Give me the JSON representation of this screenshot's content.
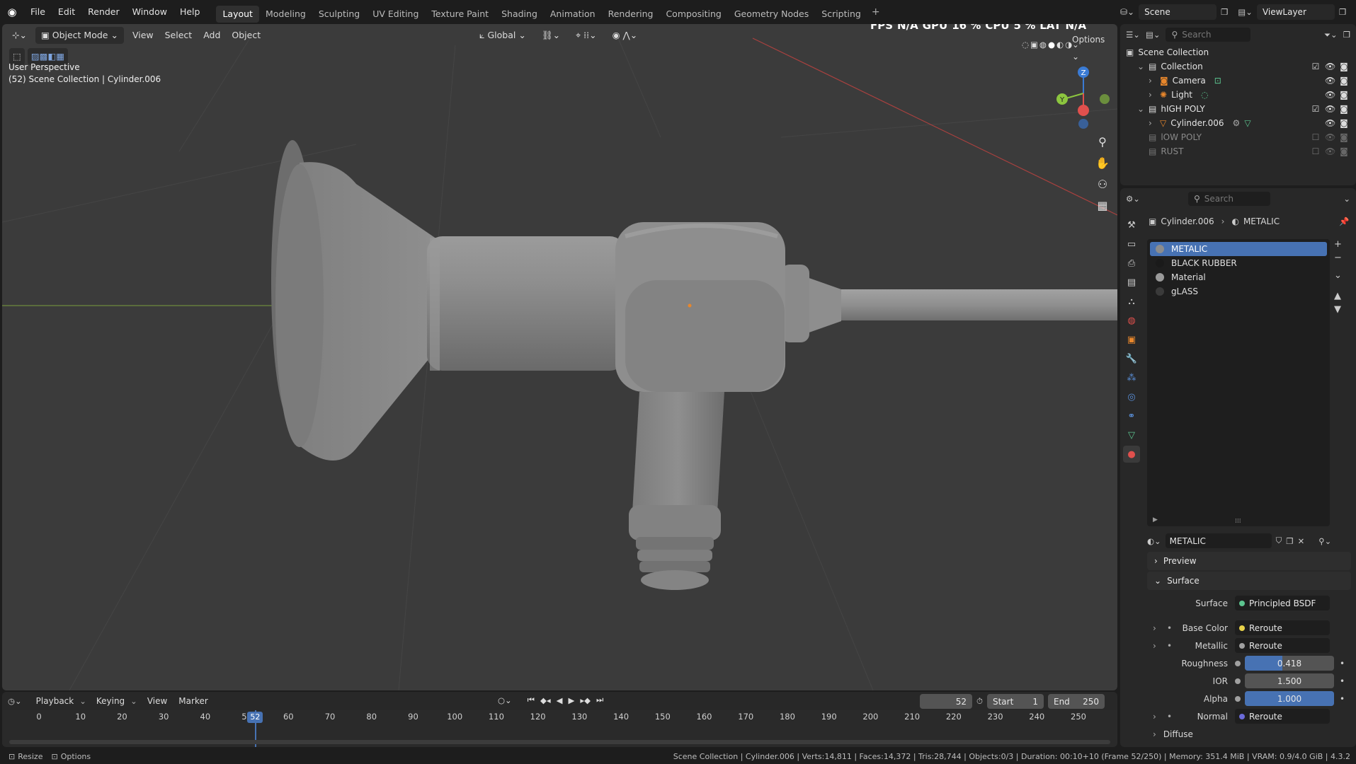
{
  "topbar": {
    "menus": [
      "File",
      "Edit",
      "Render",
      "Window",
      "Help"
    ],
    "workspaces": [
      "Layout",
      "Modeling",
      "Sculpting",
      "UV Editing",
      "Texture Paint",
      "Shading",
      "Animation",
      "Rendering",
      "Compositing",
      "Geometry Nodes",
      "Scripting"
    ],
    "active_workspace": "Layout",
    "scene": "Scene",
    "view_layer": "ViewLayer"
  },
  "viewport": {
    "mode": "Object Mode",
    "menus": [
      "View",
      "Select",
      "Add",
      "Object"
    ],
    "orientation": "Global",
    "options": "Options",
    "perspective_label": "User Perspective",
    "context_label": "(52) Scene Collection | Cylinder.006",
    "stats": {
      "fps_label": "FPS",
      "fps_value": "N/A",
      "gpu_label": "GPU",
      "gpu_value": "16 %",
      "cpu_label": "CPU",
      "cpu_value": "5 %",
      "lat_label": "LAT",
      "lat_value": "N/A"
    },
    "gizmo": {
      "z": "Z",
      "y": "Y"
    }
  },
  "outliner": {
    "search_placeholder": "Search",
    "root": "Scene Collection",
    "items": [
      {
        "label": "Collection",
        "indent": 1,
        "type": "collection",
        "dim": false
      },
      {
        "label": "Camera",
        "indent": 2,
        "type": "camera",
        "dim": false
      },
      {
        "label": "Light",
        "indent": 2,
        "type": "light",
        "dim": false
      },
      {
        "label": "hIGH POLY",
        "indent": 1,
        "type": "collection",
        "dim": false
      },
      {
        "label": "Cylinder.006",
        "indent": 2,
        "type": "mesh",
        "dim": false
      },
      {
        "label": "lOW POLY",
        "indent": 1,
        "type": "collection",
        "dim": true
      },
      {
        "label": "RUST",
        "indent": 1,
        "type": "collection",
        "dim": true
      }
    ]
  },
  "properties": {
    "search_placeholder": "Search",
    "breadcrumb_object": "Cylinder.006",
    "breadcrumb_material": "METALIC",
    "materials": [
      {
        "name": "METALIC",
        "selected": true,
        "color": "#8c8c8c"
      },
      {
        "name": "BLACK RUBBER",
        "selected": false,
        "color": "#1a1a1a"
      },
      {
        "name": "Material",
        "selected": false,
        "color": "#9a9a9a"
      },
      {
        "name": "gLASS",
        "selected": false,
        "color": "#3a3a3a"
      }
    ],
    "active_material": "METALIC",
    "panels": {
      "preview": "Preview",
      "surface": "Surface",
      "diffuse": "Diffuse"
    },
    "surface_label": "Surface",
    "surface_value": "Principled BSDF",
    "base_color_label": "Base Color",
    "base_color_value": "Reroute",
    "metallic_label": "Metallic",
    "metallic_value": "Reroute",
    "roughness_label": "Roughness",
    "roughness_value": "0.418",
    "ior_label": "IOR",
    "ior_value": "1.500",
    "alpha_label": "Alpha",
    "alpha_value": "1.000",
    "normal_label": "Normal",
    "normal_value": "Reroute"
  },
  "timeline": {
    "menus": [
      "Playback",
      "Keying",
      "View",
      "Marker"
    ],
    "current_frame": "52",
    "start_label": "Start",
    "start_value": "1",
    "end_label": "End",
    "end_value": "250",
    "ticks": [
      0,
      10,
      20,
      30,
      40,
      50,
      60,
      70,
      80,
      90,
      100,
      110,
      120,
      130,
      140,
      150,
      160,
      170,
      180,
      190,
      200,
      210,
      220,
      230,
      240,
      250
    ],
    "playhead_frame": 52,
    "frame_max": 250
  },
  "statusbar": {
    "left_action": "Resize",
    "left_options": "Options",
    "info": "Scene Collection | Cylinder.006 | Verts:14,811 | Faces:14,372 | Tris:28,744 | Objects:0/3 | Duration: 00:10+10 (Frame 52/250) | Memory: 351.4 MiB | VRAM: 0.9/4.0 GiB | 4.3.2"
  },
  "colors": {
    "accent": "#4772b3",
    "axis_x": "#e0504d",
    "axis_y": "#8cc63f",
    "axis_z": "#3a7bd5",
    "viewport_bg": "#3b3b3b",
    "panel_bg": "#282828"
  }
}
